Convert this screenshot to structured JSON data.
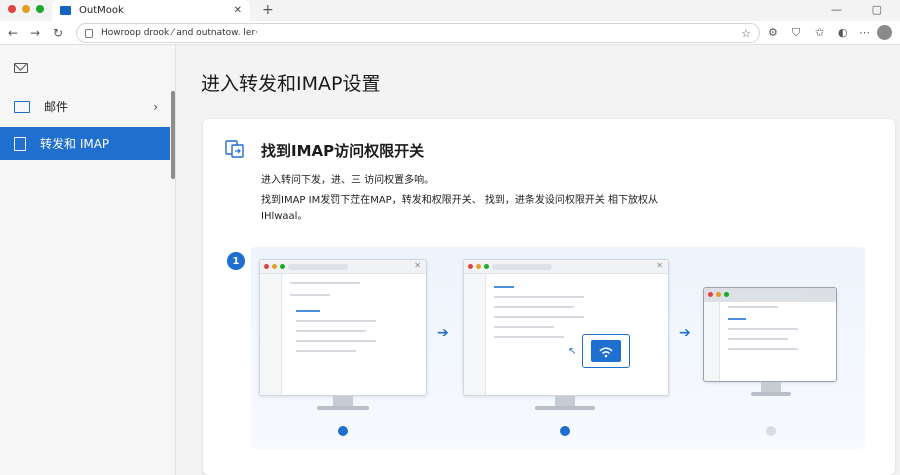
{
  "browser": {
    "tab_title": "OutMook",
    "url": "Howroop drook ⁄ and outnatow. ler·",
    "colors": {
      "dot_red": "#e0443e",
      "dot_yellow": "#dea123",
      "dot_green": "#1aab29"
    }
  },
  "sidebar": {
    "items": [
      {
        "label": "邮件",
        "icon": "mail-icon"
      },
      {
        "label": "转发和 IMAP",
        "icon": "document-icon",
        "active": true
      }
    ]
  },
  "main": {
    "title": "进入转发和IMAP设置",
    "card": {
      "title": "找到IMAP访问权限开关",
      "desc1": "进入转问下发，进、三 访问权置多响。",
      "desc2": "找到IMAP IM发罚下茳在MAP，转发和权限开关、 找到，进条发设问权限开关 相下放权从 IHlwaal。",
      "step": "1"
    }
  },
  "colors": {
    "accent": "#1f6fd0"
  }
}
